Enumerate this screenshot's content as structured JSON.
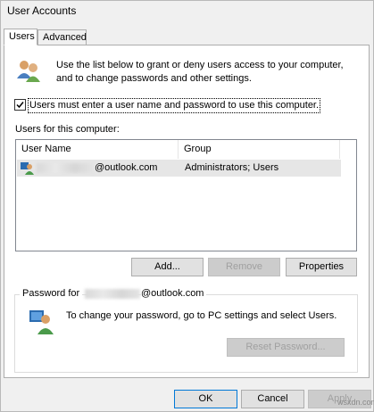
{
  "window": {
    "title": "User Accounts"
  },
  "tabs": [
    {
      "label": "Users",
      "active": true
    },
    {
      "label": "Advanced",
      "active": false
    }
  ],
  "intro_text": {
    "line1": "Use the list below to grant or deny users access to your computer,",
    "line2": "and to change passwords and other settings."
  },
  "require_login": {
    "label": "Users must enter a user name and password to use this computer.",
    "checked": true
  },
  "users_list": {
    "label": "Users for this computer:",
    "columns": [
      "User Name",
      "Group"
    ],
    "rows": [
      {
        "user_suffix": "@outlook.com",
        "group": "Administrators; Users",
        "selected": true
      }
    ]
  },
  "list_buttons": {
    "add": "Add...",
    "remove": "Remove",
    "properties": "Properties"
  },
  "password_group": {
    "title_prefix": "Password for",
    "title_suffix": "@outlook.com",
    "info": "To change your password, go to PC settings and select Users.",
    "reset_button": "Reset Password..."
  },
  "footer_buttons": {
    "ok": "OK",
    "cancel": "Cancel",
    "apply": "Apply"
  },
  "colors": {
    "selection": "#e6e6e6",
    "disabled_text": "#a0a0a0",
    "default_button_border": "#0078d7"
  },
  "watermark": "wsxdn.com"
}
